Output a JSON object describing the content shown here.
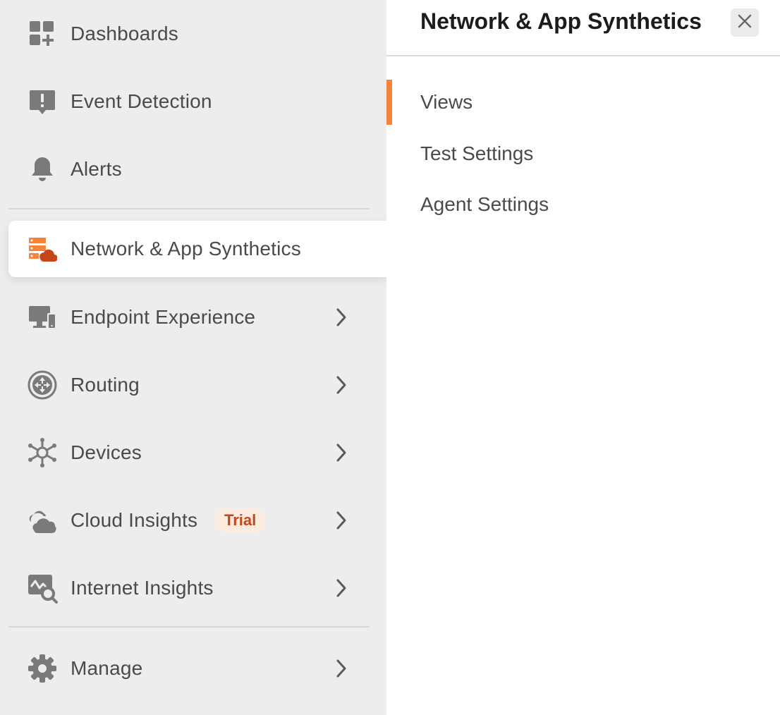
{
  "sidebar": {
    "items": [
      {
        "label": "Dashboards",
        "icon": "dashboard-add-icon"
      },
      {
        "label": "Event Detection",
        "icon": "alert-message-icon"
      },
      {
        "label": "Alerts",
        "icon": "bell-icon"
      },
      {
        "label": "Network & App Synthetics",
        "icon": "network-cloud-icon",
        "active": true
      },
      {
        "label": "Endpoint Experience",
        "icon": "endpoint-devices-icon",
        "has_submenu": true
      },
      {
        "label": "Routing",
        "icon": "routing-icon",
        "has_submenu": true
      },
      {
        "label": "Devices",
        "icon": "devices-hub-icon",
        "has_submenu": true
      },
      {
        "label": "Cloud Insights",
        "icon": "cloud-icon",
        "has_submenu": true,
        "badge": "Trial"
      },
      {
        "label": "Internet Insights",
        "icon": "internet-search-icon",
        "has_submenu": true
      },
      {
        "label": "Manage",
        "icon": "gear-icon",
        "has_submenu": true
      }
    ]
  },
  "panel": {
    "title": "Network & App Synthetics",
    "close_icon": "close-icon",
    "items": [
      {
        "label": "Views",
        "active": true
      },
      {
        "label": "Test Settings"
      },
      {
        "label": "Agent Settings"
      }
    ]
  },
  "colors": {
    "accent": "#f7823a",
    "sidebar_bg": "#ededed",
    "badge_bg": "#fdebe0",
    "badge_text": "#c4471a",
    "icon_gray": "#7a7a7a"
  }
}
